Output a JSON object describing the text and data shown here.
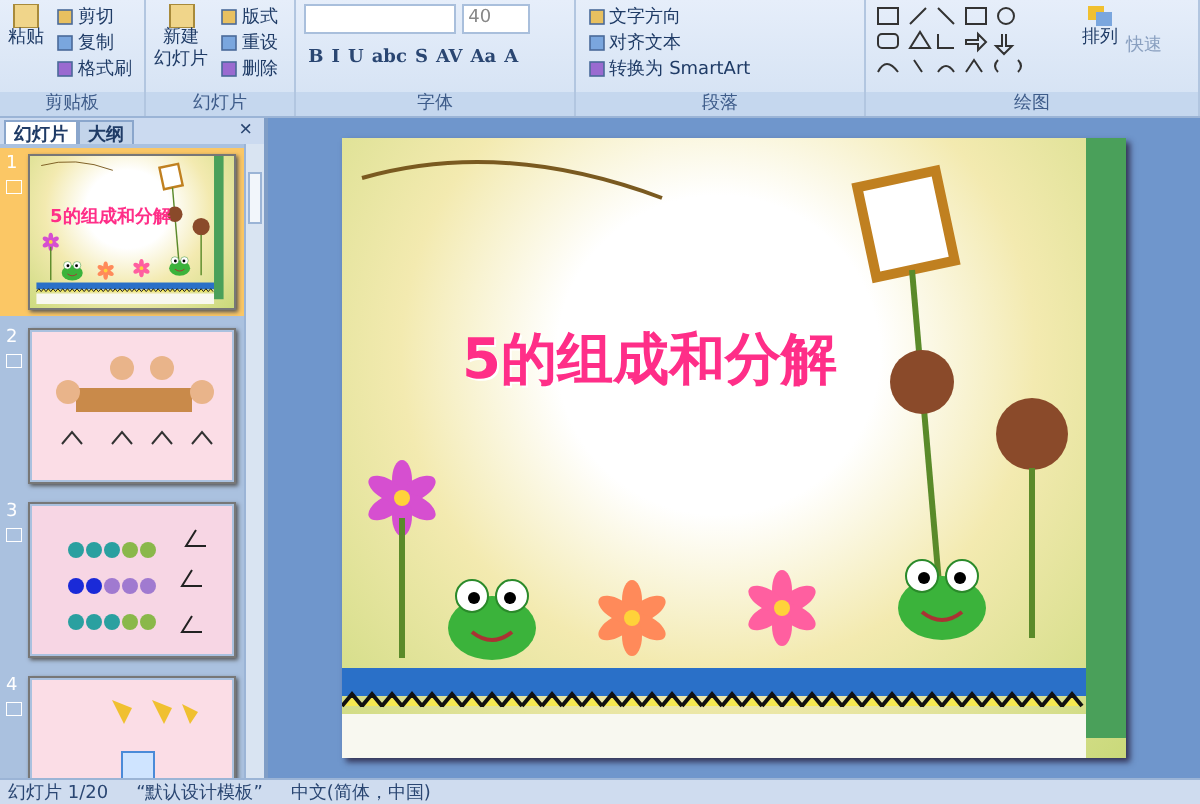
{
  "ribbon": {
    "groups": [
      {
        "label": "剪贴板",
        "large": "粘贴",
        "small": [
          "剪切",
          "复制",
          "格式刷"
        ]
      },
      {
        "label": "幻灯片",
        "large": [
          "新建",
          "幻灯片"
        ],
        "small": [
          "版式",
          "重设",
          "删除"
        ]
      },
      {
        "label": "字体",
        "font_size": "40",
        "format_buttons": [
          "B",
          "I",
          "U",
          "abc",
          "S",
          "AV",
          "Aa",
          "A"
        ]
      },
      {
        "label": "段落",
        "small": [
          "文字方向",
          "对齐文本",
          "转换为 SmartArt"
        ]
      },
      {
        "label": "绘图",
        "large": "排列",
        "extra": "快速"
      }
    ]
  },
  "panel": {
    "tabs": [
      {
        "label": "幻灯片",
        "selected": true
      },
      {
        "label": "大纲",
        "selected": false
      }
    ],
    "close": "×"
  },
  "slides": [
    {
      "number": "1",
      "selected": true,
      "kind": "title",
      "title": "5的组成和分解"
    },
    {
      "number": "2",
      "selected": false,
      "kind": "kids"
    },
    {
      "number": "3",
      "selected": false,
      "kind": "faces"
    },
    {
      "number": "4",
      "selected": false,
      "kind": "cards"
    }
  ],
  "slide": {
    "title": "5的组成和分解"
  },
  "status_bar": [
    "幻灯片 1/20",
    "“默认设计模板”",
    "中文(简体，中国)"
  ]
}
